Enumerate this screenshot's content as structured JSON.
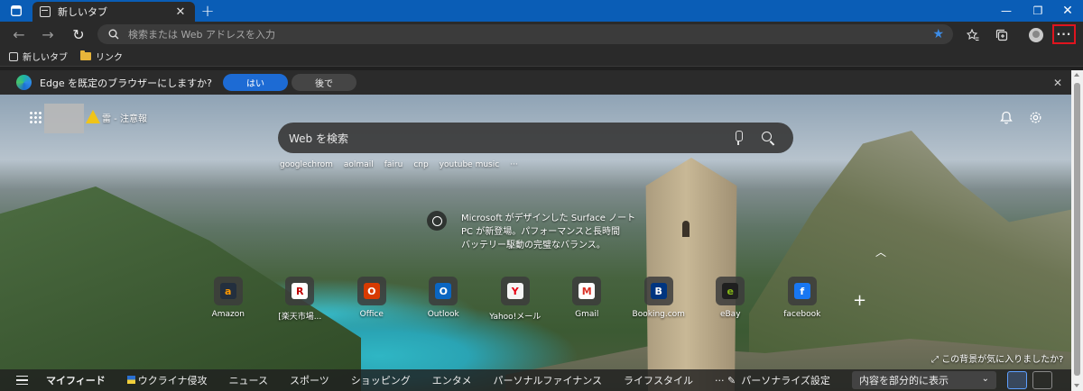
{
  "tab": {
    "title": "新しいタブ",
    "close": "✕"
  },
  "window_controls": {
    "minimize": "—",
    "maximize": "❐",
    "close": "✕"
  },
  "toolbar": {
    "new_tab": "+",
    "back": "←",
    "forward": "→",
    "refresh": "↻",
    "more": "···"
  },
  "address_bar": {
    "placeholder": "検索または Web アドレスを入力",
    "value": ""
  },
  "favorites": [
    {
      "label": "新しいタブ",
      "icon": "page-icon"
    },
    {
      "label": "リンク",
      "icon": "folder-icon"
    }
  ],
  "infobar": {
    "message": "Edge を既定のブラウザーにしますか?",
    "yes": "はい",
    "later": "後で",
    "close": "✕"
  },
  "weather": {
    "label": "雷 - 注意報",
    "icon": "lightning-warning-icon"
  },
  "search": {
    "placeholder": "Web を検索"
  },
  "suggestions": [
    "googlechrom",
    "aolmail",
    "fairu",
    "cnp",
    "youtube music",
    "···"
  ],
  "image_info": {
    "line1": "Microsoft がデザインした Surface ノート",
    "line2": "PC が新登場。パフォーマンスと長時間",
    "line3": "バッテリー駆動の完璧なバランス。"
  },
  "quick_links": [
    {
      "name": "Amazon",
      "glyph": "a",
      "color": "#232f3e",
      "fg": "#ff9900"
    },
    {
      "name": "[楽天市場...",
      "glyph": "R",
      "color": "#ffffff",
      "fg": "#bf0000"
    },
    {
      "name": "Office",
      "glyph": "O",
      "color": "#d83b01",
      "fg": "#ffffff"
    },
    {
      "name": "Outlook",
      "glyph": "O",
      "color": "#0a66c2",
      "fg": "#ffffff"
    },
    {
      "name": "Yahoo!メール",
      "glyph": "Y",
      "color": "#f5f5f5",
      "fg": "#e60012"
    },
    {
      "name": "Gmail",
      "glyph": "M",
      "color": "#ffffff",
      "fg": "#d93025"
    },
    {
      "name": "Booking.com",
      "glyph": "B",
      "color": "#003580",
      "fg": "#ffffff"
    },
    {
      "name": "eBay",
      "glyph": "e",
      "color": "#1f1f1f",
      "fg": "#86b817"
    },
    {
      "name": "facebook",
      "glyph": "f",
      "color": "#1877f2",
      "fg": "#ffffff"
    }
  ],
  "background_feedback": "この背景が気に入りましたか?",
  "feed": {
    "tabs": [
      "マイフィード",
      "ウクライナ侵攻",
      "ニュース",
      "スポーツ",
      "ショッピング",
      "エンタメ",
      "パーソナルファイナンス",
      "ライフスタイル",
      "···"
    ],
    "personalize": "パーソナライズ設定",
    "visibility": "内容を部分的に表示"
  }
}
